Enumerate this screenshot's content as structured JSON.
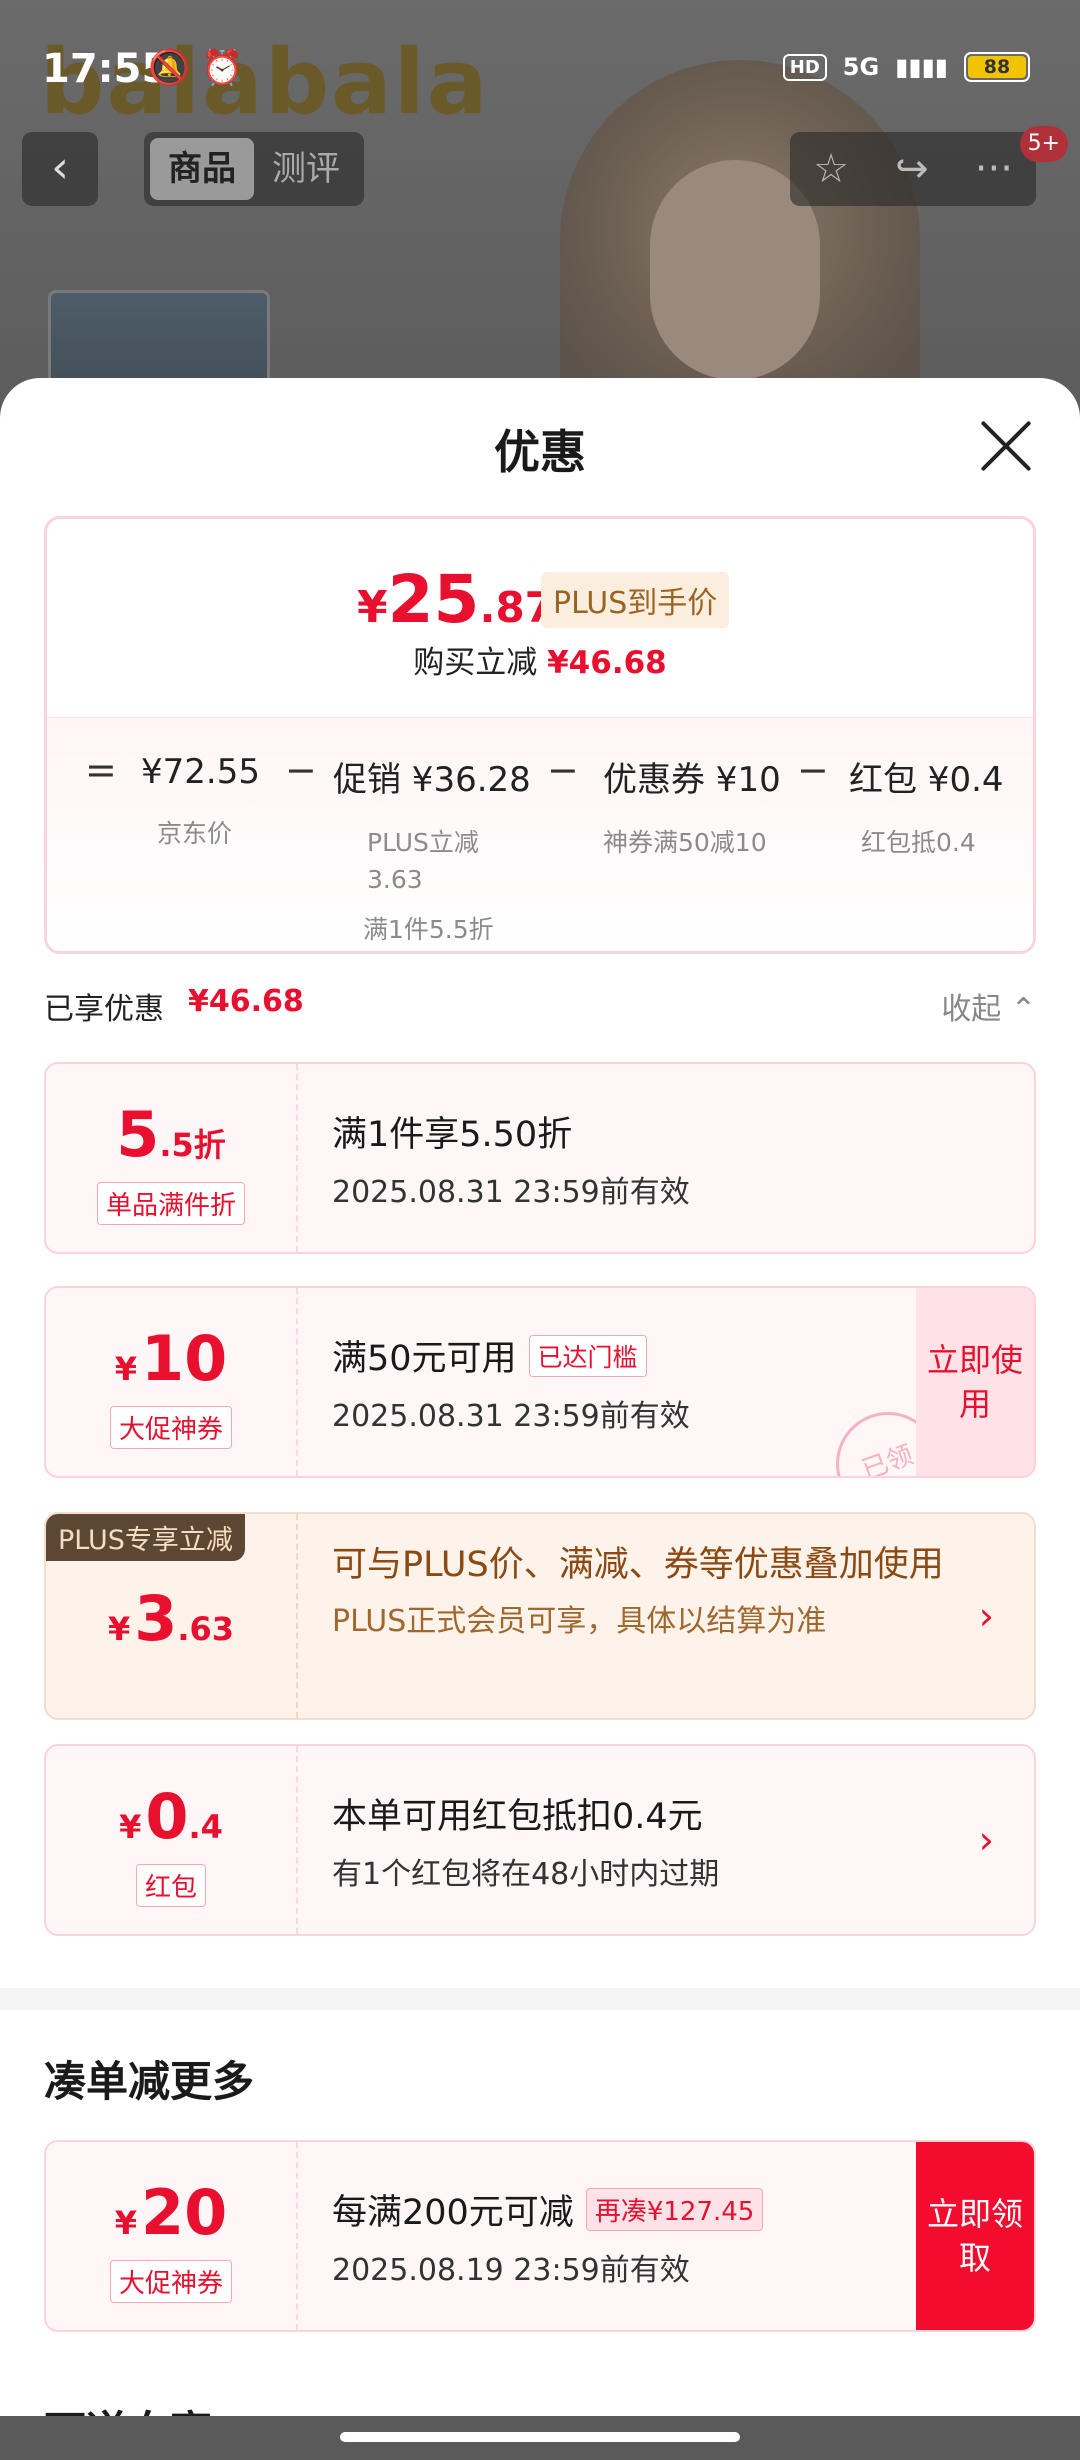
{
  "status_bar": {
    "time": "17:55",
    "icons": "🔕 ⏰",
    "hd": "HD",
    "network": "5G",
    "battery": "88"
  },
  "background": {
    "logo": "balabala"
  },
  "nav": {
    "back": "‹",
    "tabs": [
      {
        "label": "商品"
      },
      {
        "label": "测评"
      }
    ],
    "actions": {
      "favorite": "☆",
      "share": "↪",
      "more": "···",
      "badge": "5+"
    }
  },
  "sheet": {
    "title": "优惠"
  },
  "price_card": {
    "final_symbol": "¥",
    "final_int": "25",
    "final_dec": ".87",
    "plus_tag": "PLUS到手价",
    "reduce_label": "购买立减",
    "reduce_amount": "¥46.68",
    "breakdown": {
      "eq": "=",
      "jd_price": "¥72.55",
      "jd_label": "京东价",
      "minus": "−",
      "promo_amount": "促销 ¥36.28",
      "promo_sub1": "PLUS立减",
      "promo_sub2": "3.63",
      "promo_sub3": "满1件5.5折",
      "coupon_amount": "优惠券 ¥10",
      "coupon_sub": "神券满50减10",
      "redpack_amount": "红包 ¥0.4",
      "redpack_sub": "红包抵0.4"
    }
  },
  "enjoyed": {
    "label": "已享优惠",
    "amount": "¥46.68",
    "collapse": "收起 ⌃"
  },
  "coupons": [
    {
      "int": "5",
      "dec": ".5折",
      "tag": "单品满件折",
      "title": "满1件享5.50折",
      "sub": "2025.08.31 23:59前有效"
    },
    {
      "sym": "¥",
      "int": "10",
      "tag": "大促神券",
      "title": "满50元可用",
      "threshold": "已达门槛",
      "sub": "2025.08.31 23:59前有效",
      "button": "立即使用",
      "stamp": "已领"
    }
  ],
  "plus": {
    "ribbon": "PLUS专享立减",
    "sym": "¥",
    "int": "3",
    "dec": ".63",
    "title": "可与PLUS价、满减、券等优惠叠加使用",
    "sub": "PLUS正式会员可享，具体以结算为准",
    "arrow": "›"
  },
  "redpack": {
    "sym": "¥",
    "int": "0",
    "dec": ".4",
    "tag": "红包",
    "title": "本单可用红包抵扣0.4元",
    "sub": "有1个红包将在48小时内过期",
    "arrow": "›"
  },
  "more": {
    "title": "凑单减更多",
    "coupon": {
      "sym": "¥",
      "int": "20",
      "tag": "大促神券",
      "title": "每满200元可减",
      "sale": "再凑¥127.45",
      "sub": "2025.08.19 23:59前有效",
      "button": "立即领取"
    },
    "next_title": "可逆向享"
  }
}
